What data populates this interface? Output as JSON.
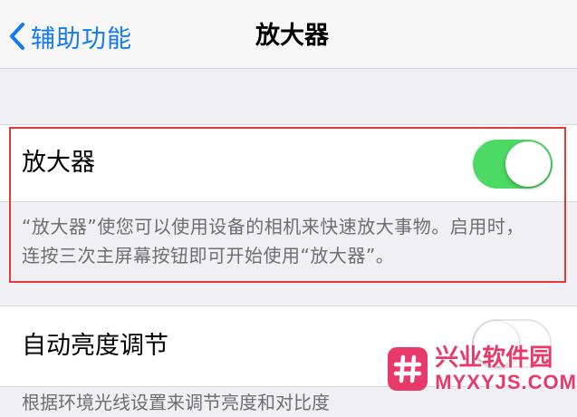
{
  "navbar": {
    "back_label": "辅助功能",
    "title": "放大器"
  },
  "magnifier": {
    "label": "放大器",
    "toggle_on": true,
    "footer": "“放大器”使您可以使用设备的相机来快速放大事物。启用时，连按三次主屏幕按钮即可开始使用“放大器”。"
  },
  "auto_brightness": {
    "label": "自动亮度调节",
    "toggle_on": false,
    "footer_partial": "根据环境光线设置来调节亮度和对比度"
  },
  "watermark": {
    "name": "兴业软件园",
    "domain": "MYXYJS.COM"
  },
  "colors": {
    "accent": "#1479f6",
    "toggle_on": "#4cd964",
    "highlight_box": "#e23a3a",
    "watermark": "#e83a6a",
    "background": "#efeff4"
  },
  "icons": {
    "back": "chevron-left-icon",
    "watermark_logo": "hash-icon"
  }
}
